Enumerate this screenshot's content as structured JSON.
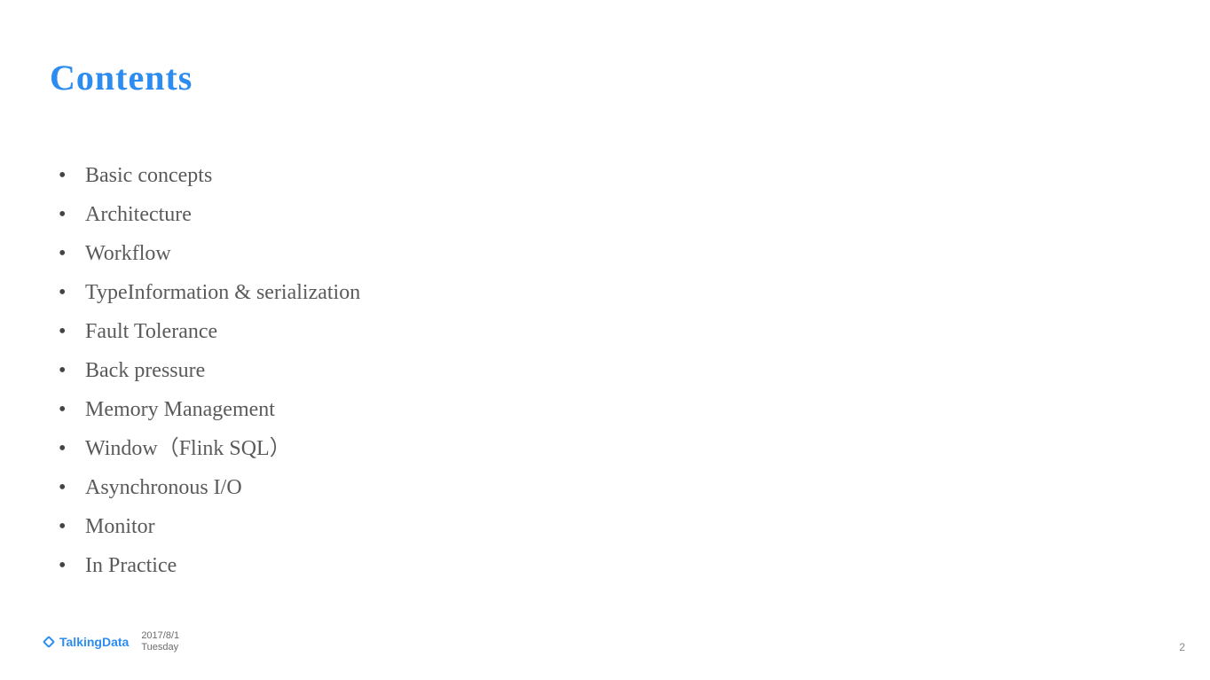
{
  "title": "Contents",
  "items": [
    "Basic concepts",
    "Architecture",
    "Workflow",
    "TypeInformation & serialization",
    "Fault Tolerance",
    "Back pressure",
    "Memory Management",
    "Window（Flink SQL）",
    "Asynchronous I/O",
    "Monitor",
    "In Practice"
  ],
  "footer": {
    "logo": "TalkingData",
    "date": "2017/8/1",
    "day": "Tuesday"
  },
  "page": "2"
}
